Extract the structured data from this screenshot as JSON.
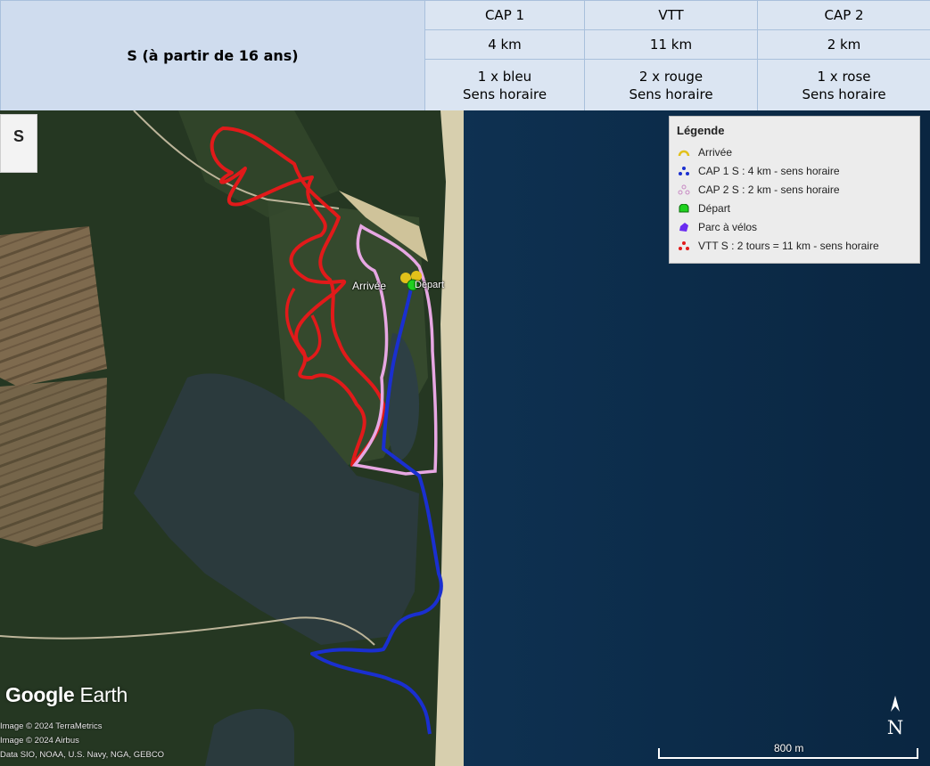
{
  "header": {
    "category": "S (à partir de 16 ans)",
    "columns": [
      {
        "name": "CAP 1",
        "distance": "4 km",
        "laps": "1 x bleu",
        "direction": "Sens horaire"
      },
      {
        "name": "VTT",
        "distance": "11 km",
        "laps": "2 x rouge",
        "direction": "Sens horaire"
      },
      {
        "name": "CAP 2",
        "distance": "2 km",
        "laps": "1 x rose",
        "direction": "Sens horaire"
      }
    ]
  },
  "map": {
    "badge": "S",
    "legend": {
      "title": "Légende",
      "items": [
        {
          "label": "Arrivée",
          "icon": "arrival-marker-icon",
          "color": "#e2c11a"
        },
        {
          "label": "CAP 1 S : 4 km - sens horaire",
          "icon": "cap1-route-icon",
          "color": "#1a2fd0"
        },
        {
          "label": "CAP 2 S : 2 km - sens horaire",
          "icon": "cap2-route-icon",
          "color": "#e7a7e3"
        },
        {
          "label": "Départ",
          "icon": "departure-marker-icon",
          "color": "#1fd11f"
        },
        {
          "label": "Parc à vélos",
          "icon": "bike-park-icon",
          "color": "#6a2cf0"
        },
        {
          "label": "VTT S : 2 tours = 11 km - sens horaire",
          "icon": "vtt-route-icon",
          "color": "#e11a1a"
        }
      ]
    },
    "labels": {
      "arrival": "Arrivée",
      "departure": "Départ"
    },
    "logo": {
      "brand": "Google",
      "product": "Earth"
    },
    "credits": [
      "Image © 2024 TerraMetrics",
      "Image © 2024 Airbus",
      "Data SIO, NOAA, U.S. Navy, NGA, GEBCO"
    ],
    "compass": "N",
    "scale": "800 m",
    "colors": {
      "vtt": "#e11a1a",
      "cap1": "#1a2fd0",
      "cap2": "#e7a7e3"
    }
  }
}
